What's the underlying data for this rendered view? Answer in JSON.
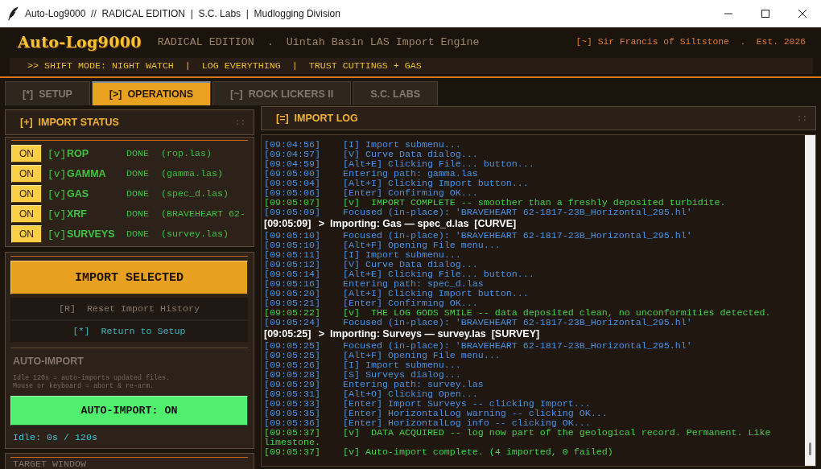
{
  "window": {
    "title": "Auto-Log9000  //  RADICAL EDITION  |  S.C. Labs  |  Mudlogging Division"
  },
  "header": {
    "logo": "Auto-Log9000",
    "tagline": "RADICAL EDITION  .  Uintah Basin LAS Import Engine",
    "credit": "[~] Sir Francis of Siltstone  .  Est. 2026",
    "ticker": ">> SHIFT MODE: NIGHT WATCH  |  LOG EVERYTHING  |  TRUST CUTTINGS + GAS"
  },
  "tabs": [
    {
      "label": "[*]  SETUP",
      "selected": false
    },
    {
      "label": "[>]  OPERATIONS",
      "selected": true
    },
    {
      "label": "[~]  ROCK LICKERS II",
      "selected": false
    },
    {
      "label": "S.C. LABS",
      "selected": false
    }
  ],
  "import_status": {
    "title": "[+]  IMPORT STATUS",
    "grip": "::",
    "items": [
      {
        "toggle": "ON",
        "check": "[v]",
        "name": "ROP",
        "status": "DONE",
        "file": "(rop.las)"
      },
      {
        "toggle": "ON",
        "check": "[v]",
        "name": "GAMMA",
        "status": "DONE",
        "file": "(gamma.las)"
      },
      {
        "toggle": "ON",
        "check": "[v]",
        "name": "GAS",
        "status": "DONE",
        "file": "(spec_d.las)"
      },
      {
        "toggle": "ON",
        "check": "[v]",
        "name": "XRF",
        "status": "DONE",
        "file": "(BRAVEHEART 62-"
      },
      {
        "toggle": "ON",
        "check": "[v]",
        "name": "SURVEYS",
        "status": "DONE",
        "file": "(survey.las)"
      }
    ]
  },
  "actions": {
    "import_button": "IMPORT SELECTED",
    "reset": "[R]  Reset Import History",
    "return": "[*]  Return to Setup"
  },
  "auto_import": {
    "title": "AUTO-IMPORT",
    "description": [
      "Idle 120s = auto-imports updated files.",
      "Mouse or keyboard = abort & re-arm."
    ],
    "button": "AUTO-IMPORT: ON",
    "on": true,
    "idle": "Idle: 0s / 120s"
  },
  "target_window": {
    "title": "TARGET WINDOW"
  },
  "import_log": {
    "title": "[=]  IMPORT LOG",
    "grip": "::",
    "lines": [
      {
        "kind": "info",
        "time": "[09:04:56]",
        "text": "[I] Import submenu..."
      },
      {
        "kind": "info",
        "time": "[09:04:57]",
        "text": "[V] Curve Data dialog..."
      },
      {
        "kind": "info",
        "time": "[09:04:59]",
        "text": "[Alt+E] Clicking File... button..."
      },
      {
        "kind": "info",
        "time": "[09:05:00]",
        "text": "Entering path: gamma.las"
      },
      {
        "kind": "info",
        "time": "[09:05:04]",
        "text": "[Alt+I] Clicking Import button..."
      },
      {
        "kind": "info",
        "time": "[09:05:06]",
        "text": "[Enter] Confirming OK..."
      },
      {
        "kind": "success",
        "time": "[09:05:07]",
        "text": "[v]  IMPORT COMPLETE -- smoother than a freshly deposited turbidite."
      },
      {
        "kind": "info",
        "time": "[09:05:09]",
        "text": "Focused (in-place): 'BRAVEHEART 62-1817-23B_Horizontal_295.hl'"
      },
      {
        "kind": "header",
        "time": "[09:05:09]",
        "text": ">  Importing: Gas — spec_d.las  [CURVE]"
      },
      {
        "kind": "info",
        "time": "[09:05:10]",
        "text": "Focused (in-place): 'BRAVEHEART 62-1817-23B_Horizontal_295.hl'"
      },
      {
        "kind": "info",
        "time": "[09:05:10]",
        "text": "[Alt+F] Opening File menu..."
      },
      {
        "kind": "info",
        "time": "[09:05:11]",
        "text": "[I] Import submenu..."
      },
      {
        "kind": "info",
        "time": "[09:05:12]",
        "text": "[V] Curve Data dialog..."
      },
      {
        "kind": "info",
        "time": "[09:05:14]",
        "text": "[Alt+E] Clicking File... button..."
      },
      {
        "kind": "info",
        "time": "[09:05:16]",
        "text": "Entering path: spec_d.las"
      },
      {
        "kind": "info",
        "time": "[09:05:20]",
        "text": "[Alt+I] Clicking Import button..."
      },
      {
        "kind": "info",
        "time": "[09:05:21]",
        "text": "[Enter] Confirming OK..."
      },
      {
        "kind": "success",
        "time": "[09:05:22]",
        "text": "[v]  THE LOG GODS SMILE -- data deposited clean, no unconformities detected."
      },
      {
        "kind": "info",
        "time": "[09:05:24]",
        "text": "Focused (in-place): 'BRAVEHEART 62-1817-23B_Horizontal_295.hl'"
      },
      {
        "kind": "header",
        "time": "[09:05:25]",
        "text": ">  Importing: Surveys — survey.las  [SURVEY]"
      },
      {
        "kind": "info",
        "time": "[09:05:25]",
        "text": "Focused (in-place): 'BRAVEHEART 62-1817-23B_Horizontal_295.hl'"
      },
      {
        "kind": "info",
        "time": "[09:05:25]",
        "text": "[Alt+F] Opening File menu..."
      },
      {
        "kind": "info",
        "time": "[09:05:26]",
        "text": "[I] Import submenu..."
      },
      {
        "kind": "info",
        "time": "[09:05:28]",
        "text": "[S] Surveys dialog..."
      },
      {
        "kind": "info",
        "time": "[09:05:29]",
        "text": "Entering path: survey.las"
      },
      {
        "kind": "info",
        "time": "[09:05:31]",
        "text": "[Alt+O] Clicking Open..."
      },
      {
        "kind": "info",
        "time": "[09:05:33]",
        "text": "[Enter] Import Surveys -- clicking Import..."
      },
      {
        "kind": "info",
        "time": "[09:05:35]",
        "text": "[Enter] HorizontalLog warning -- clicking OK..."
      },
      {
        "kind": "info",
        "time": "[09:05:36]",
        "text": "[Enter] HorizontalLog info -- clicking OK..."
      },
      {
        "kind": "success",
        "time": "[09:05:37]",
        "text": "[v]  DATA ACQUIRED -- log now part of the geological record. Permanent. Like limestone."
      },
      {
        "kind": "success",
        "time": "[09:05:37]",
        "text": "[v] Auto-import complete. (4 imported, 0 failed)"
      }
    ]
  }
}
